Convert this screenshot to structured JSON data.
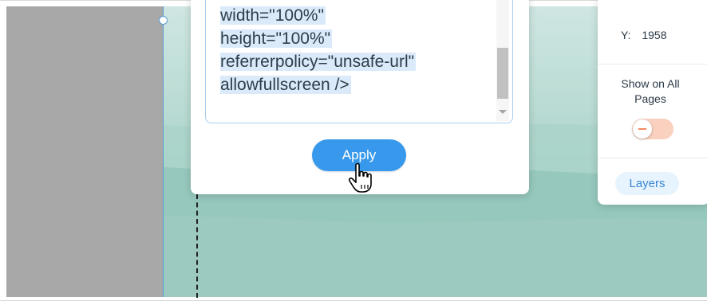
{
  "embed_code": {
    "lines": [
      "width=\"100%\"",
      "height=\"100%\"",
      "referrerpolicy=\"unsafe-url\"",
      "allowfullscreen />"
    ],
    "apply_label": "Apply"
  },
  "right_panel": {
    "y_label": "Y:",
    "y_value": "1958",
    "show_on_all_pages_label": "Show on All Pages",
    "show_on_all_pages_enabled": false,
    "layers_label": "Layers"
  },
  "icons": {
    "cursor": "hand-pointer-icon",
    "toggle": "minus-icon"
  },
  "colors": {
    "accent": "#3899ec",
    "selection": "#dbeafa",
    "toggle_off": "#fad0bf",
    "toggle_mark": "#f28a5c",
    "guide": "#5b9bd5"
  }
}
